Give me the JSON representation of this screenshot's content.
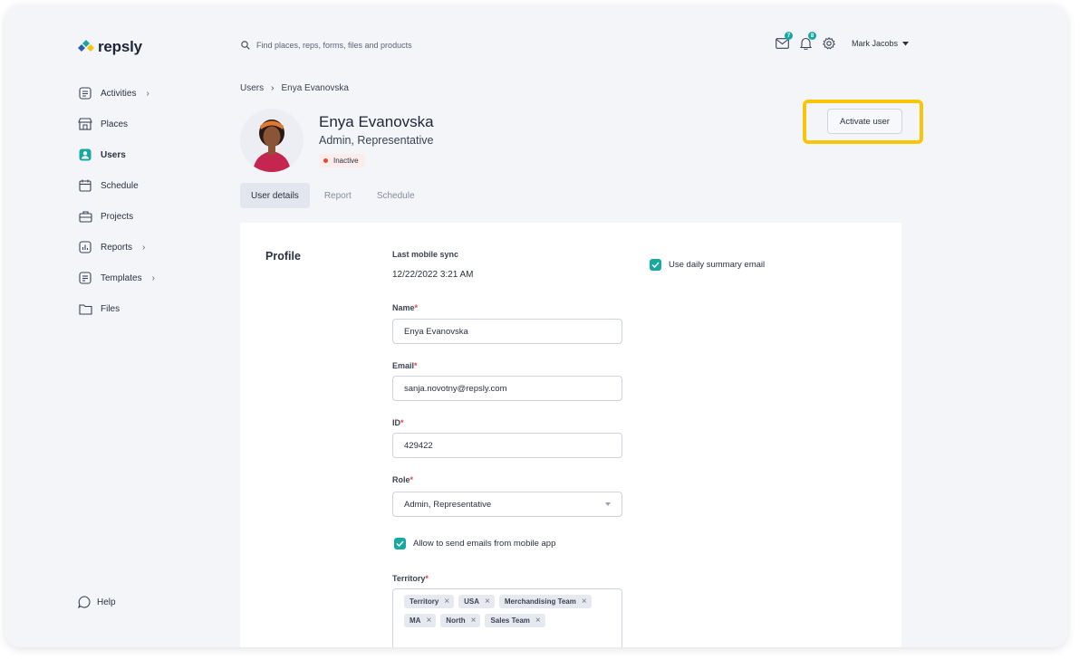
{
  "header": {
    "logo_text": "repsly",
    "search_placeholder": "Find places, reps, forms, files and products",
    "messages_badge": "7",
    "notifications_badge": "8",
    "user_name": "Mark Jacobs"
  },
  "sidebar": {
    "items": [
      {
        "label": "Activities",
        "icon": "activities-icon",
        "has_chevron": true
      },
      {
        "label": "Places",
        "icon": "store-icon",
        "has_chevron": false
      },
      {
        "label": "Users",
        "icon": "user-icon",
        "active": true
      },
      {
        "label": "Schedule",
        "icon": "calendar-icon"
      },
      {
        "label": "Projects",
        "icon": "briefcase-icon"
      },
      {
        "label": "Reports",
        "icon": "chart-icon",
        "has_chevron": true
      },
      {
        "label": "Templates",
        "icon": "template-icon",
        "has_chevron": true
      },
      {
        "label": "Files",
        "icon": "folder-icon"
      }
    ],
    "help_label": "Help"
  },
  "breadcrumb": {
    "root": "Users",
    "current": "Enya Evanovska"
  },
  "user": {
    "name": "Enya Evanovska",
    "role": "Admin, Representative",
    "status": "Inactive",
    "status_color": "#e8453c"
  },
  "actions": {
    "activate_label": "Activate user",
    "highlight_color": "#f7c608"
  },
  "tabs": [
    {
      "label": "User details",
      "active": true
    },
    {
      "label": "Report"
    },
    {
      "label": "Schedule"
    }
  ],
  "profile": {
    "section_title": "Profile",
    "last_sync_label": "Last mobile sync",
    "last_sync_value": "12/22/2022 3:21 AM",
    "name_label": "Name",
    "name_value": "Enya Evanovska",
    "email_label": "Email",
    "email_value": "sanja.novotny@repsly.com",
    "id_label": "ID",
    "id_value": "429422",
    "role_label": "Role",
    "role_value": "Admin, Representative",
    "allow_email_label": "Allow to send emails from mobile app",
    "allow_email_checked": true,
    "daily_summary_label": "Use daily summary email",
    "daily_summary_checked": true,
    "territory_label": "Territory",
    "territories": [
      "Territory",
      "USA",
      "Merchandising Team",
      "MA",
      "North",
      "Sales Team"
    ],
    "required_marker": "*"
  },
  "colors": {
    "accent": "#17a9a0",
    "background": "#f4f5f9"
  }
}
